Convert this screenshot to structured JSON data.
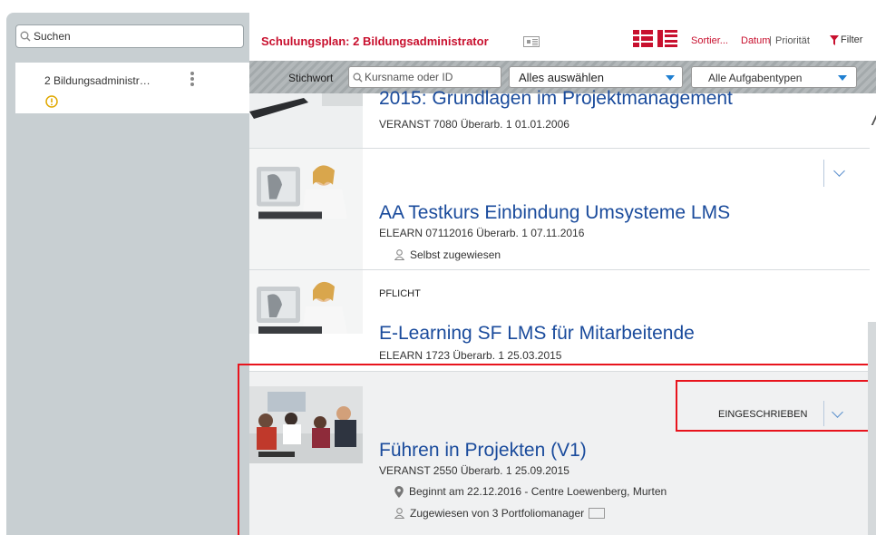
{
  "sidebar": {
    "search_placeholder": "Suchen",
    "plans": [
      {
        "label": "2 Bildungsadministr…"
      }
    ]
  },
  "header": {
    "title": "Schulungsplan: 2 Bildungsadministrator",
    "sort_label": "Sortier...",
    "sort_date": "Datum",
    "sort_separator": "|",
    "sort_priority": "Priorität",
    "filter_label": "Filter"
  },
  "filter_bar": {
    "keyword_label": "Stichwort",
    "keyword_placeholder": "Kursname oder ID",
    "select_all": "Alles auswählen",
    "task_types": "Alle Aufgabentypen"
  },
  "courses": [
    {
      "title": "2015: Grundlagen im Projektmanagement",
      "meta": "VERANST 7080 Überarb. 1 01.01.2006"
    },
    {
      "title": "AA Testkurs Einbindung Umsysteme LMS",
      "meta": "ELEARN 07112016 Überarb. 1 07.11.2016",
      "assignment": "Selbst zugewiesen"
    },
    {
      "tag": "PFLICHT",
      "title": "E-Learning SF LMS für Mitarbeitende",
      "meta": "ELEARN 1723 Überarb. 1 25.03.2015"
    },
    {
      "status": "EINGESCHRIEBEN",
      "title": "Führen in Projekten (V1)",
      "meta": "VERANST 2550 Überarb. 1 25.09.2015",
      "location": "Beginnt am 22.12.2016 - Centre Loewenberg, Murten",
      "assignment": "Zugewiesen von 3 Portfoliomanager"
    }
  ],
  "colors": {
    "brand_red": "#c8102e",
    "link_blue": "#1a4b9c",
    "highlight_red": "#e8141d"
  }
}
